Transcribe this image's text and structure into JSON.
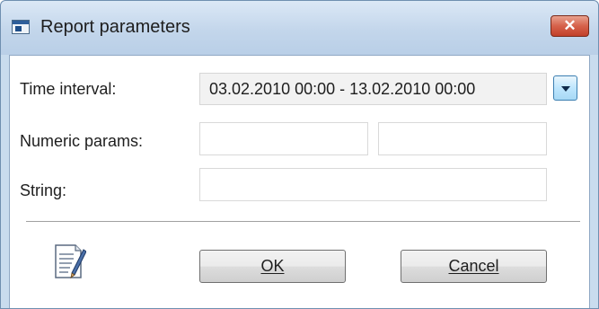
{
  "window": {
    "title": "Report parameters",
    "close_label": "✕"
  },
  "form": {
    "time_interval": {
      "label": "Time interval:",
      "value": "03.02.2010 00:00 - 13.02.2010 00:00"
    },
    "numeric_params": {
      "label": "Numeric params:",
      "value1": "",
      "value2": ""
    },
    "string": {
      "label": "String:",
      "value": ""
    }
  },
  "buttons": {
    "ok_label": "OK",
    "cancel_label": "Cancel"
  },
  "icons": {
    "title": "window-icon",
    "dropdown": "chevron-down-icon",
    "report": "report-edit-icon",
    "close": "close-icon"
  }
}
